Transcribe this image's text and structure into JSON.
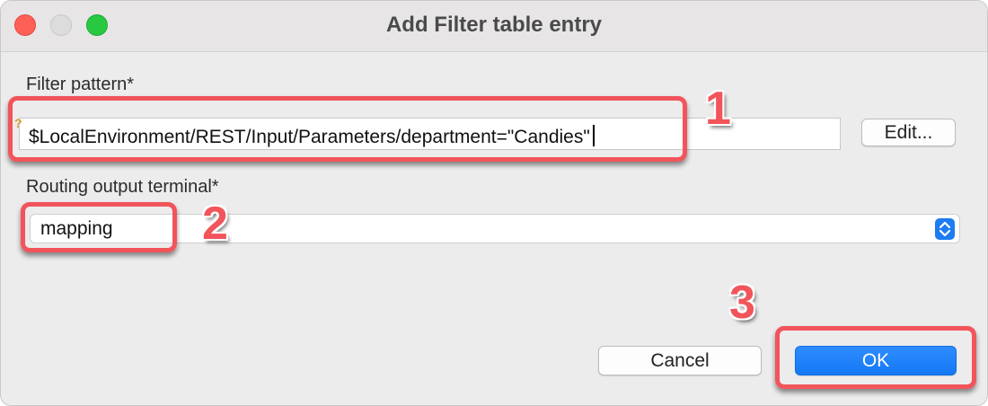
{
  "window": {
    "title": "Add Filter table entry",
    "controls": [
      "close",
      "minimize",
      "maximize"
    ]
  },
  "filter_pattern": {
    "label": "Filter pattern*",
    "value": "$LocalEnvironment/REST/Input/Parameters/department=\"Candies\"",
    "edit_button": "Edit...",
    "warning_icon": "warning-marker-icon"
  },
  "routing": {
    "label": "Routing output terminal*",
    "value": "mapping",
    "stepper_icon": "updown-chevron-icon"
  },
  "buttons": {
    "cancel": "Cancel",
    "ok": "OK"
  },
  "annotations": {
    "step1": "1",
    "step2": "2",
    "step3": "3",
    "color": "#f2545b"
  },
  "colors": {
    "accent": "#1479f5",
    "close": "#fe5f57",
    "maximize": "#28c840"
  }
}
